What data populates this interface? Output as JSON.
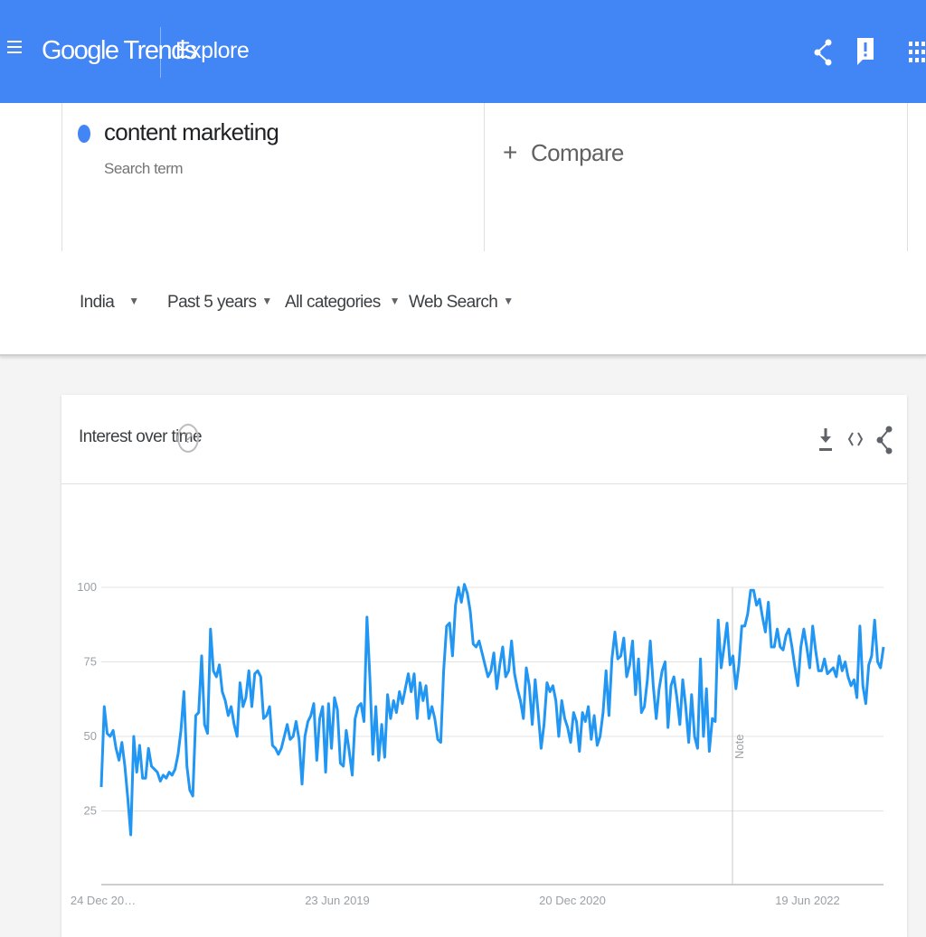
{
  "header": {
    "logo_text": "Google Trends",
    "page_label": "Explore",
    "color": "#4285f4"
  },
  "search": {
    "term": "content marketing",
    "term_type": "Search term",
    "term_color": "#4285f4",
    "compare_label": "Compare"
  },
  "filters": {
    "region": "India",
    "time_range": "Past 5 years",
    "category": "All categories",
    "search_type": "Web Search"
  },
  "card": {
    "title": "Interest over time"
  },
  "chart_data": {
    "type": "line",
    "y_ticks": [
      "100",
      "75",
      "50",
      "25"
    ],
    "x_tick_labels": [
      "24 Dec 20…",
      "23 Jun 2019",
      "20 Dec 2020",
      "19 Jun 2022"
    ],
    "ylim": [
      0,
      100
    ],
    "grid": true,
    "annotation": "Note",
    "series": [
      {
        "color": "#2196f3",
        "values": [
          33,
          60,
          51,
          50,
          52,
          46,
          42,
          48,
          40,
          29,
          17,
          50,
          38,
          47,
          36,
          36,
          46,
          40,
          39,
          38,
          35,
          37,
          36,
          38,
          37,
          39,
          44,
          52,
          65,
          40,
          32,
          30,
          57,
          58,
          77,
          54,
          51,
          86,
          72,
          70,
          74,
          65,
          62,
          57,
          60,
          54,
          50,
          68,
          60,
          63,
          72,
          60,
          71,
          72,
          70,
          56,
          57,
          60,
          47,
          46,
          44,
          46,
          50,
          54,
          49,
          50,
          55,
          49,
          34,
          50,
          55,
          57,
          61,
          42,
          56,
          60,
          38,
          61,
          46,
          63,
          59,
          41,
          40,
          52,
          45,
          37,
          56,
          60,
          61,
          55,
          90,
          70,
          44,
          60,
          42,
          54,
          43,
          64,
          56,
          62,
          58,
          65,
          61,
          66,
          71,
          65,
          71,
          56,
          68,
          62,
          67,
          56,
          60,
          56,
          49,
          48,
          72,
          87,
          88,
          77,
          94,
          100,
          95,
          101,
          98,
          92,
          81,
          80,
          82,
          78,
          74,
          70,
          72,
          78,
          66,
          74,
          80,
          70,
          72,
          82,
          71,
          66,
          62,
          56,
          73,
          67,
          54,
          69,
          58,
          46,
          54,
          68,
          65,
          67,
          62,
          50,
          62,
          56,
          53,
          48,
          58,
          55,
          45,
          58,
          55,
          60,
          49,
          57,
          47,
          50,
          58,
          72,
          57,
          76,
          85,
          76,
          77,
          83,
          70,
          74,
          82,
          64,
          76,
          58,
          60,
          69,
          82,
          67,
          56,
          66,
          72,
          75,
          53,
          67,
          70,
          63,
          54,
          69,
          60,
          48,
          64,
          50,
          46,
          76,
          50,
          66,
          45,
          56,
          55,
          89,
          73,
          80,
          88,
          74,
          77,
          66,
          74,
          87,
          87,
          91,
          99,
          99,
          94,
          96,
          90,
          85,
          95,
          80,
          80,
          86,
          80,
          79,
          84,
          86,
          80,
          73,
          67,
          80,
          86,
          80,
          73,
          87,
          79,
          72,
          72,
          76,
          71,
          72,
          73,
          70,
          77,
          72,
          75,
          70,
          67,
          69,
          63,
          87,
          67,
          61,
          74,
          77,
          89,
          75,
          73,
          80
        ]
      }
    ]
  }
}
